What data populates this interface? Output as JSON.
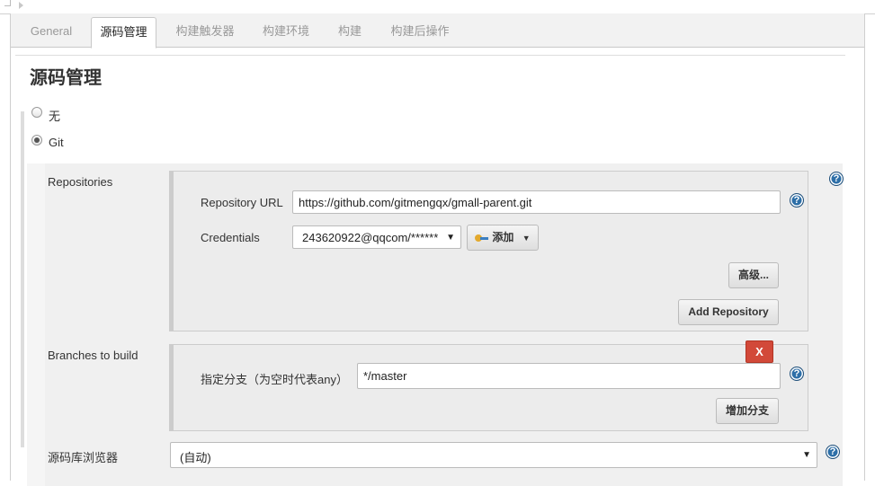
{
  "tabs": [
    {
      "label": "General",
      "active": false
    },
    {
      "label": "源码管理",
      "active": true
    },
    {
      "label": "构建触发器",
      "active": false
    },
    {
      "label": "构建环境",
      "active": false
    },
    {
      "label": "构建",
      "active": false
    },
    {
      "label": "构建后操作",
      "active": false
    }
  ],
  "section_title": "源码管理",
  "scm_options": [
    {
      "label": "无",
      "checked": false
    },
    {
      "label": "Git",
      "checked": true
    }
  ],
  "repositories": {
    "label": "Repositories",
    "url_label": "Repository URL",
    "url_value": "https://github.com/gitmengqx/gmall-parent.git",
    "credentials_label": "Credentials",
    "credentials_value": "243620922@qqcom/******",
    "add_button": "添加",
    "advanced_button": "高级...",
    "add_repository_button": "Add Repository"
  },
  "branches": {
    "label": "Branches to build",
    "delete_button": "X",
    "branch_label": "指定分支（为空时代表any）",
    "branch_value": "*/master",
    "add_branch_button": "增加分支"
  },
  "browser": {
    "label": "源码库浏览器",
    "value": "(自动)"
  },
  "icons": {
    "help": "help-icon",
    "dropdown": "chevron-down-icon",
    "key": "key-icon"
  },
  "help_symbol": "?",
  "colors": {
    "help_blue": "#2d6fa8",
    "danger_red": "#d24939"
  }
}
